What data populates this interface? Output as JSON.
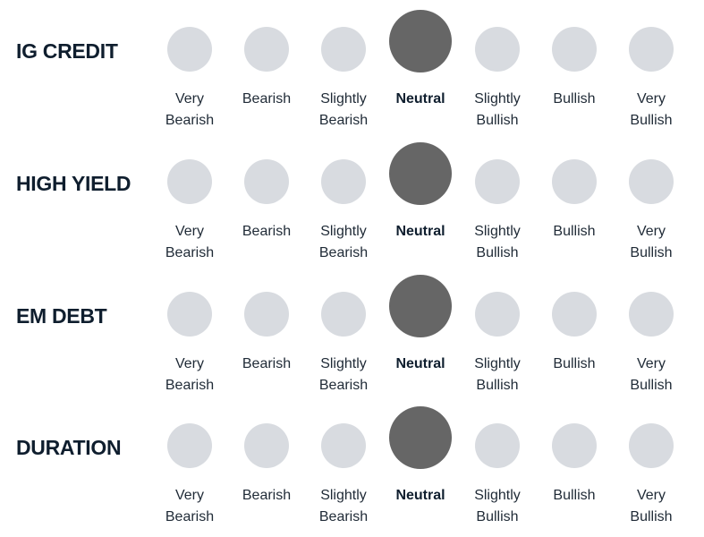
{
  "scale": {
    "options": [
      {
        "line1": "Very",
        "line2": "Bearish"
      },
      {
        "line1": "Bearish",
        "line2": ""
      },
      {
        "line1": "Slightly",
        "line2": "Bearish"
      },
      {
        "line1": "Neutral",
        "line2": ""
      },
      {
        "line1": "Slightly",
        "line2": "Bullish"
      },
      {
        "line1": "Bullish",
        "line2": ""
      },
      {
        "line1": "Very",
        "line2": "Bullish"
      }
    ]
  },
  "colors": {
    "active": "#666666",
    "inactive": "#d8dbe0",
    "text": "#0f1e2e"
  },
  "rows": [
    {
      "label": "IG CREDIT",
      "selected_index": 3,
      "selected_label": "Neutral"
    },
    {
      "label": "HIGH YIELD",
      "selected_index": 3,
      "selected_label": "Neutral"
    },
    {
      "label": "EM DEBT",
      "selected_index": 3,
      "selected_label": "Neutral"
    },
    {
      "label": "DURATION",
      "selected_index": 3,
      "selected_label": "Neutral"
    }
  ]
}
